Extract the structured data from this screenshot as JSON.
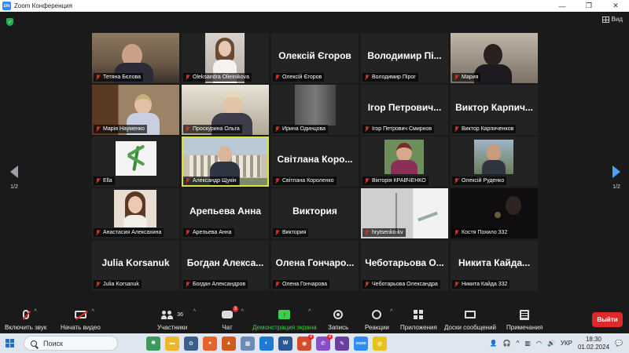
{
  "window": {
    "title": "Zoom Конференция",
    "app_badge": "zm"
  },
  "view_label": "Вид",
  "pagination": {
    "left": "1/2",
    "right": "1/2"
  },
  "participants": [
    {
      "name": "Тетяна Бєлова",
      "video": "room1"
    },
    {
      "name": "Oleksandra Olieinikova",
      "video": "portrait"
    },
    {
      "name": "Олексій Єгоров",
      "display": "Олексій Єгоров"
    },
    {
      "name": "Володимир Пірог",
      "display": "Володимир Пі..."
    },
    {
      "name": "Мария",
      "video": "room2"
    },
    {
      "name": "Марія Науменко",
      "video": "shelf"
    },
    {
      "name": "Проскурина Ольга",
      "video": "kitchen"
    },
    {
      "name": "Ирина Одинцова",
      "video": "dim"
    },
    {
      "name": "Ігор Петрович Смирнов",
      "display": "Ігор Петрович..."
    },
    {
      "name": "Виктор Карпиченков",
      "display": "Виктор Карпич..."
    },
    {
      "name": "Ella",
      "video": "leaf"
    },
    {
      "name": "Александр Щукін",
      "video": "building",
      "active": true
    },
    {
      "name": "Світлана Короленко",
      "display": "Світлана Коро..."
    },
    {
      "name": "Вікторія КРАВЧЕНКО",
      "video": "photo1"
    },
    {
      "name": "Олексій Руденко",
      "video": "photo2"
    },
    {
      "name": "Анастасия Алексахина",
      "video": "girl"
    },
    {
      "name": "Арепьева Анна",
      "display": "Арепьева Анна"
    },
    {
      "name": "Виктория",
      "display": "Виктория"
    },
    {
      "name": "hrytsenko-kv",
      "video": "white"
    },
    {
      "name": "Костя Похило 332",
      "video": "dark"
    },
    {
      "name": "Julia Korsanuk",
      "display": "Julia Korsanuk"
    },
    {
      "name": "Богдан Александров",
      "display": "Богдан Алекса..."
    },
    {
      "name": "Олена Гончарова",
      "display": "Олена Гончаро..."
    },
    {
      "name": "Чеботарьова Олександра",
      "display": "Чеботарьова О..."
    },
    {
      "name": "Никита Кайда 332",
      "display": "Никита Кайда..."
    }
  ],
  "toolbar": {
    "mic": "Включить звук",
    "video": "Начать видео",
    "participants": "Участники",
    "participants_count": "36",
    "chat": "Чат",
    "chat_badge": "3",
    "share": "Демонстрация экрана",
    "record": "Запись",
    "reactions": "Реакции",
    "apps": "Приложения",
    "whiteboards": "Доски сообщений",
    "notes": "Примечания",
    "leave": "Выйти"
  },
  "taskbar": {
    "search_placeholder": "Поиск",
    "lang": "УКР",
    "time": "18:30",
    "date": "01.02.2024",
    "badge_a": "2",
    "badge_b": "2"
  },
  "colors": {
    "leave": "#e02828",
    "share": "#3ccf4a",
    "active_speaker": "#d9e23a"
  }
}
